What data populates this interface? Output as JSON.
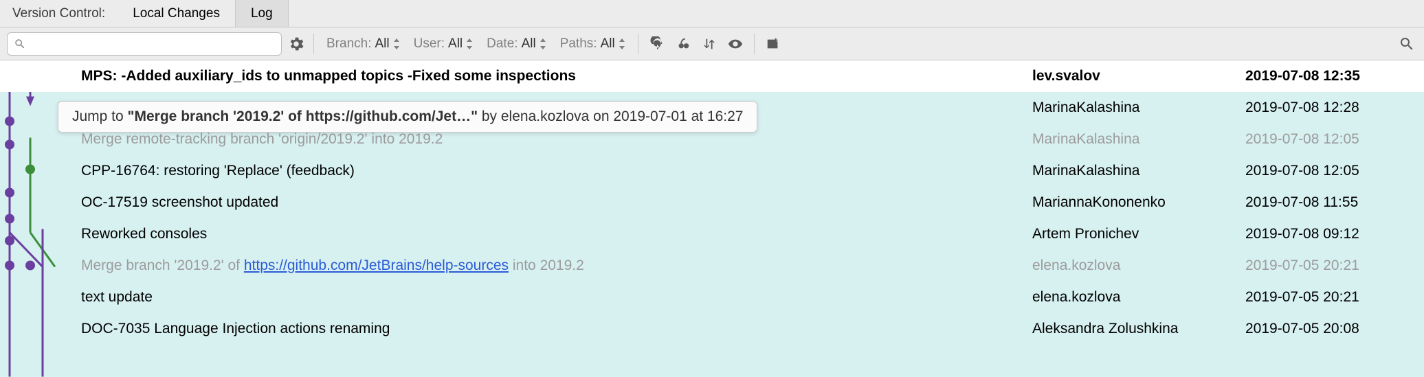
{
  "header": {
    "title": "Version Control:",
    "tabs": [
      "Local Changes",
      "Log"
    ],
    "active_tab_index": 1
  },
  "toolbar": {
    "search_placeholder": "",
    "filters": [
      {
        "label": "Branch:",
        "value": "All"
      },
      {
        "label": "User:",
        "value": "All"
      },
      {
        "label": "Date:",
        "value": "All"
      },
      {
        "label": "Paths:",
        "value": "All"
      }
    ]
  },
  "tooltip": {
    "prefix": "Jump to ",
    "quoted": "\"Merge branch '2019.2' of https://github.com/Jet…\"",
    "suffix": " by elena.kozlova on 2019-07-01 at 16:27"
  },
  "graph": {
    "colors": {
      "purple": "#6b3fa0",
      "green": "#3b8f3b"
    }
  },
  "commits": [
    {
      "selected": true,
      "merge": false,
      "msg": "MPS: -Added auxiliary_ids to unmapped topics -Fixed some inspections",
      "author": "lev.svalov",
      "date": "2019-07-08 12:35"
    },
    {
      "selected": false,
      "merge": false,
      "msg": "",
      "author": "MarinaKalashina",
      "date": "2019-07-08 12:28"
    },
    {
      "selected": false,
      "merge": true,
      "msg": "Merge remote-tracking branch 'origin/2019.2' into 2019.2",
      "author": "MarinaKalashina",
      "date": "2019-07-08 12:05"
    },
    {
      "selected": false,
      "merge": false,
      "msg": "CPP-16764: restoring 'Replace' (feedback)",
      "author": "MarinaKalashina",
      "date": "2019-07-08 12:05"
    },
    {
      "selected": false,
      "merge": false,
      "msg": "OC-17519 screenshot updated",
      "author": "MariannaKononenko",
      "date": "2019-07-08 11:55"
    },
    {
      "selected": false,
      "merge": false,
      "msg": "Reworked consoles",
      "author": "Artem Pronichev",
      "date": "2019-07-08 09:12"
    },
    {
      "selected": false,
      "merge": true,
      "msg_parts": [
        "Merge branch '2019.2' of ",
        {
          "link": "https://github.com/JetBrains/help-sources"
        },
        " into 2019.2"
      ],
      "author": "elena.kozlova",
      "date": "2019-07-05 20:21"
    },
    {
      "selected": false,
      "merge": false,
      "msg": "text update",
      "author": "elena.kozlova",
      "date": "2019-07-05 20:21"
    },
    {
      "selected": false,
      "merge": false,
      "msg": "DOC-7035 Language Injection actions renaming",
      "author": "Aleksandra Zolushkina",
      "date": "2019-07-05 20:08"
    }
  ]
}
